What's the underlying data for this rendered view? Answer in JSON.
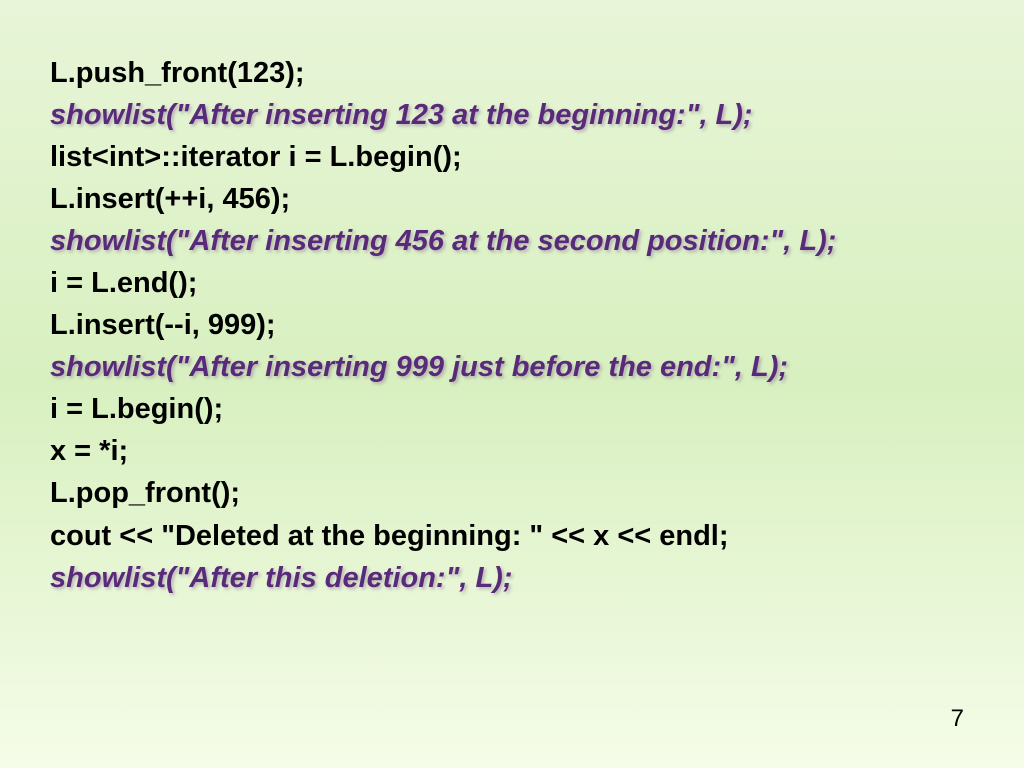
{
  "code": {
    "line1": "L.push_front(123);",
    "line2": "showlist(\"After inserting 123 at the beginning:\", L);",
    "line3": "list<int>::iterator i = L.begin();",
    "line4": "L.insert(++i, 456);",
    "line5": "showlist(\"After inserting 456 at the second position:\", L);",
    "line6": "i = L.end();",
    "line7": "L.insert(--i,  999);",
    "line8": "showlist(\"After inserting 999 just before the end:\",  L);",
    "line9": "i = L.begin();",
    "line10": "x = *i;",
    "line11": "L.pop_front();",
    "line12": "cout << \"Deleted at the beginning: \"  << x << endl;",
    "line13": "showlist(\"After this deletion:\",  L);"
  },
  "page_number": "7"
}
